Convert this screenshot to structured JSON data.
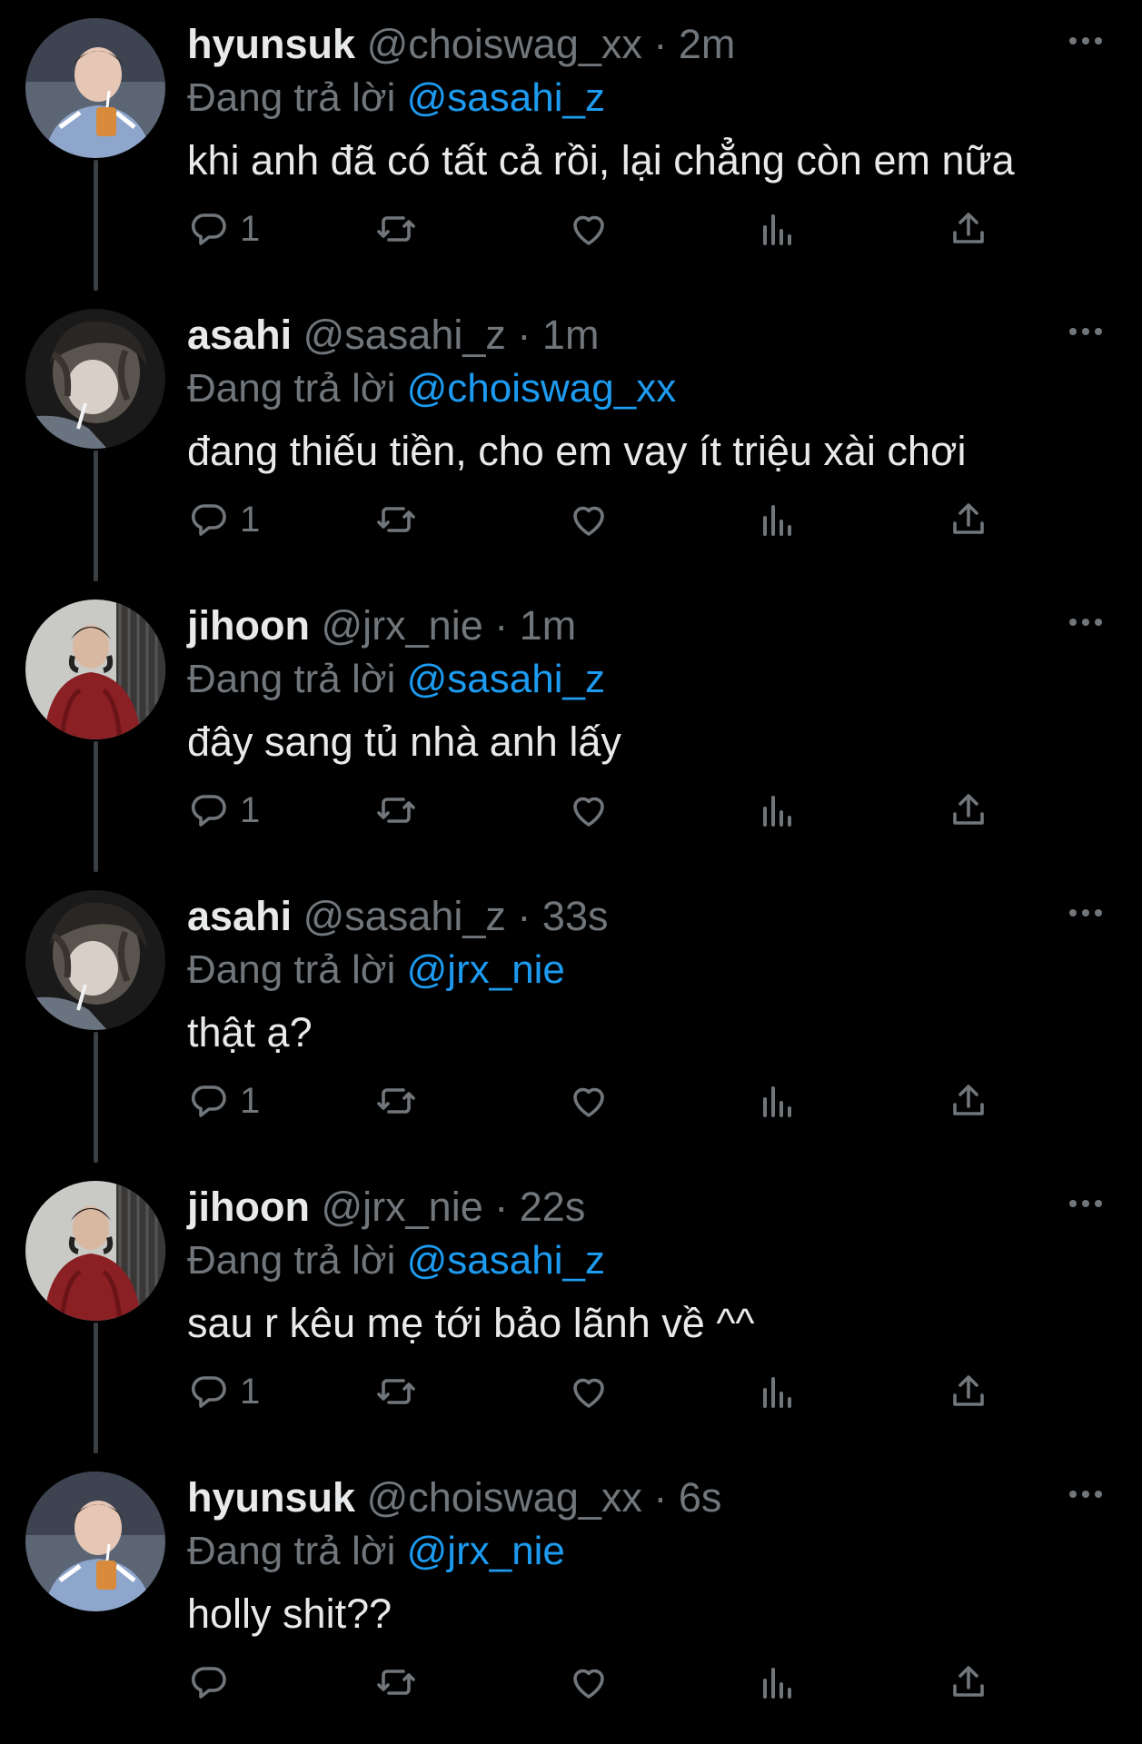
{
  "reply_prefix": "Đang trả lời",
  "separator": "·",
  "colors": {
    "background": "#000000",
    "text": "#e7e9ea",
    "muted": "#71767b",
    "link": "#1d9bf0"
  },
  "icons": {
    "reply": "reply-icon",
    "retweet": "retweet-icon",
    "like": "heart-icon",
    "views": "views-icon",
    "share": "share-icon",
    "more": "more-icon"
  },
  "tweets": [
    {
      "display_name": "hyunsuk",
      "handle": "@choiswag_xx",
      "time": "2m",
      "reply_to": "@sasahi_z",
      "text": "khi anh đã có tất cả rồi, lại chẳng còn em nữa",
      "reply_count": "1",
      "avatar": "hyunsuk-avatar"
    },
    {
      "display_name": "asahi",
      "handle": "@sasahi_z",
      "time": "1m",
      "reply_to": "@choiswag_xx",
      "text": "đang thiếu tiền, cho em vay ít triệu xài chơi",
      "reply_count": "1",
      "avatar": "asahi-avatar"
    },
    {
      "display_name": "jihoon",
      "handle": "@jrx_nie",
      "time": "1m",
      "reply_to": "@sasahi_z",
      "text": "đây sang tủ nhà anh lấy",
      "reply_count": "1",
      "avatar": "jihoon-avatar"
    },
    {
      "display_name": "asahi",
      "handle": "@sasahi_z",
      "time": "33s",
      "reply_to": "@jrx_nie",
      "text": "thật ạ?",
      "reply_count": "1",
      "avatar": "asahi-avatar"
    },
    {
      "display_name": "jihoon",
      "handle": "@jrx_nie",
      "time": "22s",
      "reply_to": "@sasahi_z",
      "text": "sau r kêu mẹ tới bảo lãnh về ^^",
      "reply_count": "1",
      "avatar": "jihoon-avatar"
    },
    {
      "display_name": "hyunsuk",
      "handle": "@choiswag_xx",
      "time": "6s",
      "reply_to": "@jrx_nie",
      "text": "holly shit??",
      "reply_count": "",
      "avatar": "hyunsuk-avatar"
    }
  ]
}
